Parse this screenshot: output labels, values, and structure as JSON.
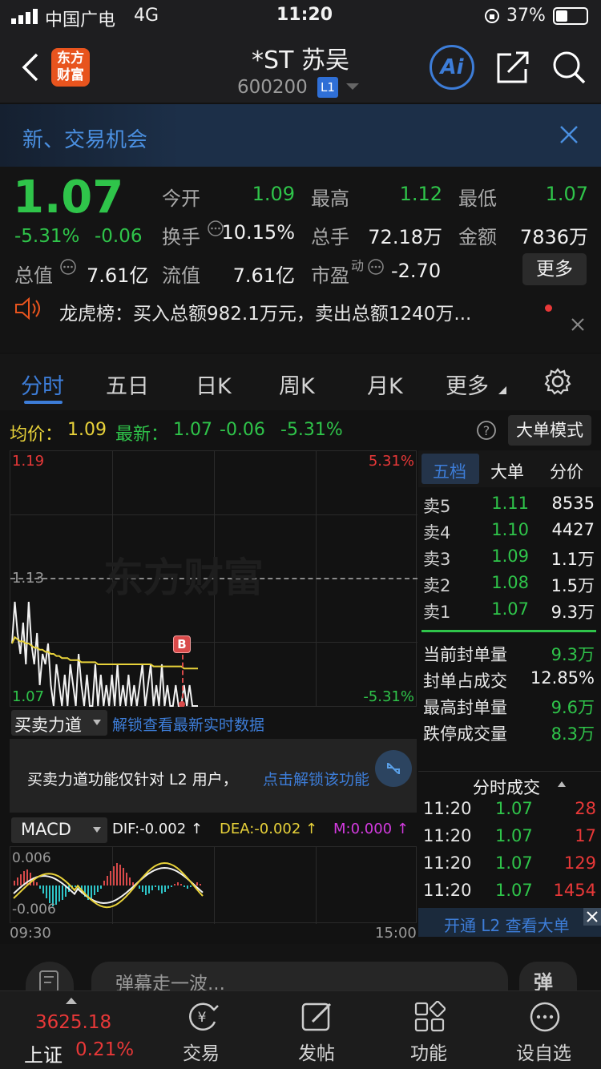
{
  "status_bar": {
    "carrier": "中国广电",
    "network": "4G",
    "time": "11:20",
    "battery": "37%"
  },
  "header": {
    "title": "*ST 苏吴",
    "code": "600200",
    "level_badge": "L1",
    "logo_line1": "东方",
    "logo_line2": "财富",
    "ai_label": "Ai"
  },
  "banner": {
    "text": "新、交易机会"
  },
  "quote": {
    "price": "1.07",
    "change_pct": "-5.31%",
    "change": "-0.06",
    "fields": {
      "open_label": "今开",
      "open": "1.09",
      "high_label": "最高",
      "high": "1.12",
      "low_label": "最低",
      "low": "1.07",
      "turnover_label": "换手",
      "turnover": "10.15%",
      "volume_label": "总手",
      "volume": "72.18万",
      "amount_label": "金额",
      "amount": "7836万",
      "mktcap_label": "总值",
      "mktcap": "7.61亿",
      "float_label": "流值",
      "float": "7.61亿",
      "pe_label": "市盈",
      "pe_sup": "动",
      "pe": "-2.70"
    },
    "more_button": "更多"
  },
  "notice": {
    "text": "龙虎榜：买入总额982.1万元，卖出总额1240万..."
  },
  "tabs": [
    "分时",
    "五日",
    "日K",
    "周K",
    "月K",
    "更多"
  ],
  "chart_bar": {
    "avg_label": "均价：",
    "avg": "1.09",
    "latest_label": "最新：",
    "latest": "1.07",
    "change": "-0.06",
    "change_pct": "-5.31%",
    "mode_button": "大单模式"
  },
  "chart_data": {
    "type": "line",
    "axis_left": {
      "top": "1.19",
      "mid": "1.13",
      "bottom": "1.07"
    },
    "axis_right": {
      "top": "5.31%",
      "bottom": "-5.31%"
    },
    "ylim": [
      1.07,
      1.19
    ],
    "reference_price": 1.13,
    "marker": "B",
    "time_start": "09:30",
    "time_end": "15:00",
    "watermark": "东方财富",
    "series": [
      {
        "values": [
          1.1,
          1.12,
          1.105,
          1.095,
          1.11,
          1.09,
          1.12,
          1.1,
          1.09,
          1.105,
          1.08,
          1.095,
          1.09,
          1.1,
          1.08,
          1.07,
          1.09,
          1.08,
          1.07,
          1.085,
          1.07,
          1.09,
          1.08,
          1.07,
          1.095,
          1.08,
          1.07,
          1.085,
          1.07,
          1.07,
          1.09,
          1.07,
          1.085,
          1.07,
          1.08,
          1.07,
          1.085,
          1.07,
          1.09,
          1.07,
          1.08,
          1.07,
          1.085,
          1.07,
          1.08,
          1.07,
          1.08,
          1.09,
          1.07,
          1.08,
          1.09,
          1.07,
          1.08,
          1.07,
          1.09,
          1.07,
          1.08,
          1.07,
          1.07,
          1.08,
          1.07,
          1.07,
          1.08,
          1.07,
          1.08,
          1.07,
          1.07,
          1.07
        ]
      },
      {
        "values": [
          1.1,
          1.103,
          1.102,
          1.101,
          1.101,
          1.1,
          1.1,
          1.099,
          1.098,
          1.098,
          1.097,
          1.097,
          1.096,
          1.096,
          1.095,
          1.095,
          1.094,
          1.094,
          1.093,
          1.093,
          1.093,
          1.092,
          1.092,
          1.092,
          1.092,
          1.091,
          1.091,
          1.091,
          1.091,
          1.091,
          1.091,
          1.09,
          1.09,
          1.09,
          1.09,
          1.09,
          1.09,
          1.09,
          1.09,
          1.09,
          1.09,
          1.09,
          1.09,
          1.09,
          1.09,
          1.09,
          1.09,
          1.09,
          1.09,
          1.09,
          1.09,
          1.089,
          1.089,
          1.089,
          1.089,
          1.089,
          1.089,
          1.089,
          1.089,
          1.089,
          1.089,
          1.089,
          1.088,
          1.088,
          1.088,
          1.088,
          1.088,
          1.088
        ]
      }
    ]
  },
  "orderbook": {
    "tabs": [
      "五档",
      "大单",
      "分价"
    ],
    "asks": [
      {
        "label": "卖5",
        "price": "1.11",
        "vol": "8535"
      },
      {
        "label": "卖4",
        "price": "1.10",
        "vol": "4427"
      },
      {
        "label": "卖3",
        "price": "1.09",
        "vol": "1.1万"
      },
      {
        "label": "卖2",
        "price": "1.08",
        "vol": "1.5万"
      },
      {
        "label": "卖1",
        "price": "1.07",
        "vol": "9.3万"
      }
    ],
    "stats": [
      {
        "label": "当前封单量",
        "value": "9.3万",
        "color": "green"
      },
      {
        "label": "封单占成交",
        "value": "12.85%",
        "color": "white"
      },
      {
        "label": "最高封单量",
        "value": "9.6万",
        "color": "green"
      },
      {
        "label": "跌停成交量",
        "value": "8.3万",
        "color": "green"
      }
    ]
  },
  "ticks": {
    "title": "分时成交",
    "rows": [
      {
        "time": "11:20",
        "price": "1.07",
        "vol": "28"
      },
      {
        "time": "11:20",
        "price": "1.07",
        "vol": "17"
      },
      {
        "time": "11:20",
        "price": "1.07",
        "vol": "129"
      },
      {
        "time": "11:20",
        "price": "1.07",
        "vol": "1454"
      }
    ],
    "l2_button": "开通 L2 查看大单"
  },
  "force": {
    "selector": "买卖力道",
    "unlock_link": "解锁查看最新实时数据",
    "notice": "买卖力道功能仅针对 L2 用户，",
    "notice_link": "点击解锁该功能"
  },
  "macd": {
    "selector": "MACD",
    "dif": "DIF:-0.002 ↑",
    "dea": "DEA:-0.002 ↑",
    "m": "M:0.000 ↑",
    "top": "0.006",
    "bottom": "-0.006"
  },
  "comment": {
    "placeholder": "弹幕走一波...",
    "btn": "弹"
  },
  "bottom_nav": {
    "index_value": "3625.18",
    "index_name": "上证",
    "index_pct": "0.21%",
    "items": [
      "交易",
      "发帖",
      "功能",
      "设自选"
    ]
  }
}
